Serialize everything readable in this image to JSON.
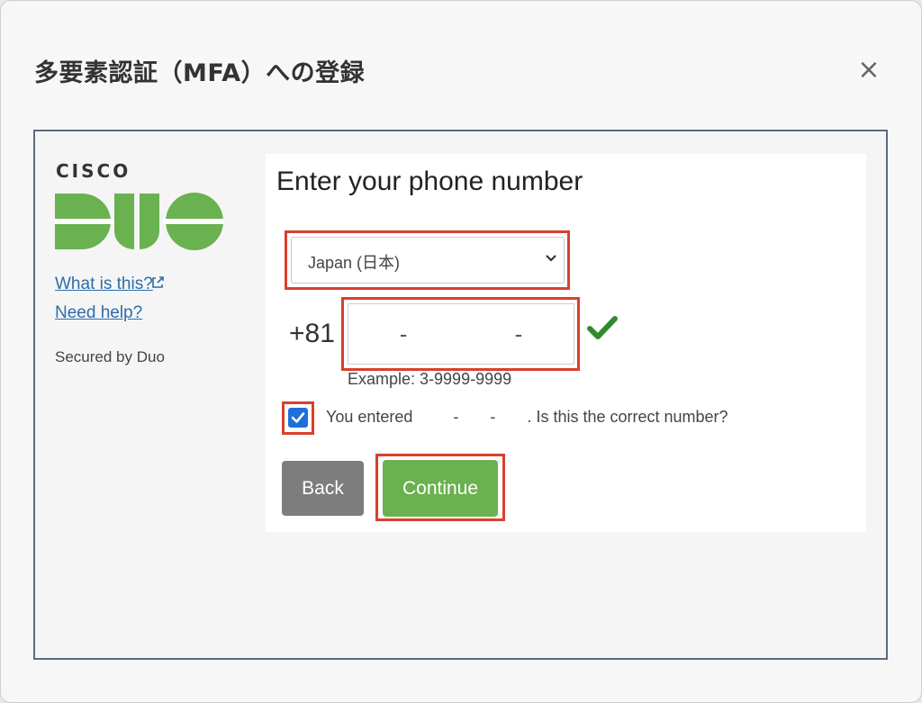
{
  "dialog": {
    "title": "多要素認証（MFA）への登録",
    "close_glyph": "×"
  },
  "sidebar": {
    "brand": "CISCO",
    "logo_name": "duo-logo",
    "links": [
      {
        "label": "What is this?"
      },
      {
        "label": "Need help?"
      }
    ],
    "secured_by": "Secured by Duo"
  },
  "form": {
    "title": "Enter your phone number",
    "country": {
      "selected": "Japan (日本)"
    },
    "country_code": "+81",
    "phone": {
      "value": "-   -"
    },
    "example": "Example: 3-9999-9999",
    "confirm": {
      "checked": true,
      "text": "You entered         -       -       . Is this the correct number?"
    },
    "buttons": {
      "back": "Back",
      "continue": "Continue"
    }
  },
  "colors": {
    "highlight": "#d8402e",
    "duo_green": "#6ab150",
    "link": "#2a6ea8",
    "check_green": "#2e8b2e"
  }
}
